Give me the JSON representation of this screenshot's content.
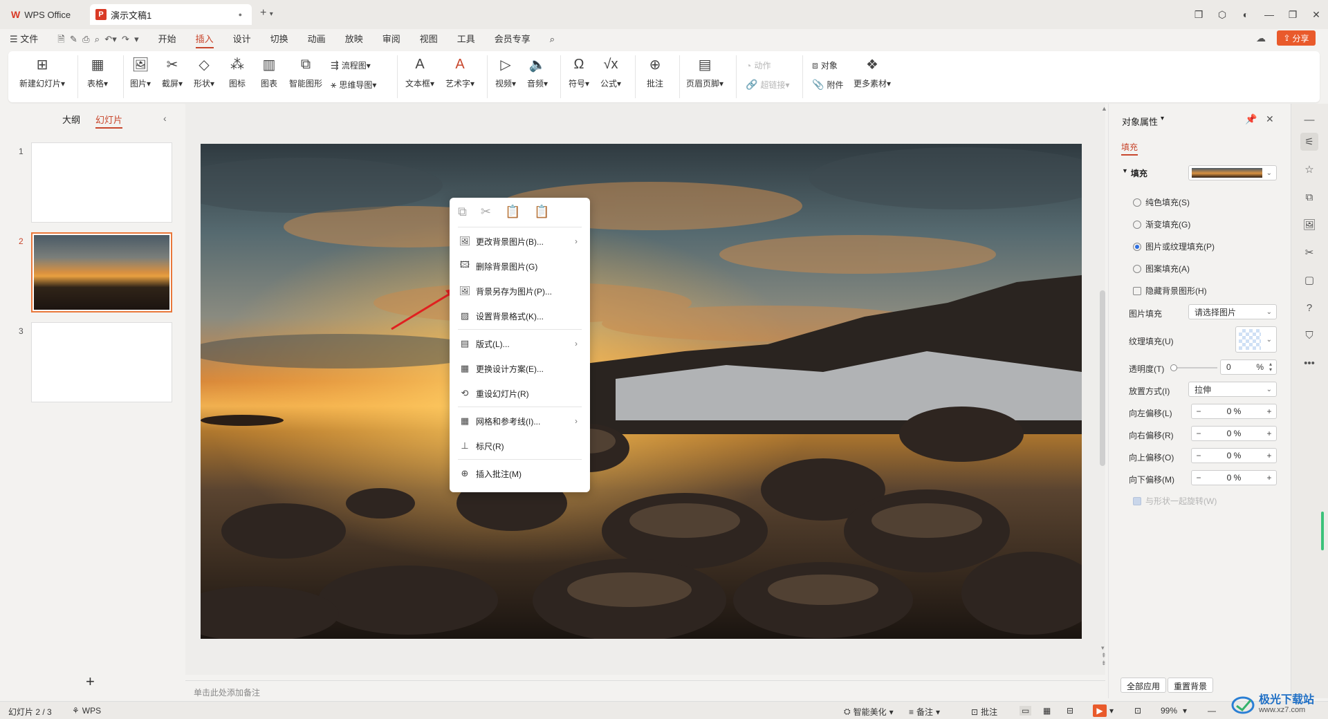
{
  "titlebar": {
    "wps_tab": "WPS Office",
    "doc_tab": "演示文稿1",
    "new_tab": "+"
  },
  "menubar": {
    "file": "文件",
    "items": [
      "开始",
      "插入",
      "设计",
      "切换",
      "动画",
      "放映",
      "审阅",
      "视图",
      "工具",
      "会员专享"
    ],
    "active": "插入",
    "share": "分享"
  },
  "ribbon": {
    "new_slide": "新建幻灯片",
    "table": "表格",
    "picture": "图片",
    "screenshot": "截屏",
    "shape": "形状",
    "icon": "图标",
    "chart": "图表",
    "smart_graphic": "智能图形",
    "flowchart": "流程图",
    "mindmap": "思维导图",
    "textbox": "文本框",
    "wordart": "艺术字",
    "video": "视频",
    "audio": "音频",
    "symbol": "符号",
    "formula": "公式",
    "comment": "批注",
    "header_footer": "页眉页脚",
    "action": "动作",
    "hyperlink": "超链接",
    "object": "对象",
    "attachment": "附件",
    "more_materials": "更多素材"
  },
  "left_panel": {
    "tab_outline": "大纲",
    "tab_slides": "幻灯片",
    "slides": [
      "1",
      "2",
      "3"
    ],
    "selected_slide": 2
  },
  "context_menu": {
    "items": [
      {
        "label": "更改背景图片(B)...",
        "submenu": true
      },
      {
        "label": "删除背景图片(G)",
        "submenu": false
      },
      {
        "label": "背景另存为图片(P)...",
        "submenu": false
      },
      {
        "label": "设置背景格式(K)...",
        "submenu": false
      },
      {
        "label": "版式(L)...",
        "submenu": true
      },
      {
        "label": "更换设计方案(E)...",
        "submenu": false
      },
      {
        "label": "重设幻灯片(R)",
        "submenu": false
      },
      {
        "label": "网格和参考线(I)...",
        "submenu": true
      },
      {
        "label": "标尺(R)",
        "submenu": false
      },
      {
        "label": "插入批注(M)",
        "submenu": false
      }
    ]
  },
  "notes": {
    "placeholder": "单击此处添加备注"
  },
  "right_panel": {
    "title": "对象属性",
    "tab": "填充",
    "section": "填充",
    "options": [
      "纯色填充(S)",
      "渐变填充(G)",
      "图片或纹理填充(P)",
      "图案填充(A)"
    ],
    "selected_option": "图片或纹理填充(P)",
    "hide_bg": "隐藏背景图形(H)",
    "picture_fill_label": "图片填充",
    "picture_fill_value": "请选择图片",
    "texture_fill_label": "纹理填充(U)",
    "transparency_label": "透明度(T)",
    "transparency_value": "0",
    "transparency_unit": "%",
    "placement_label": "放置方式(I)",
    "placement_value": "拉伸",
    "offsets": [
      {
        "label": "向左偏移(L)",
        "value": "0 %"
      },
      {
        "label": "向右偏移(R)",
        "value": "0 %"
      },
      {
        "label": "向上偏移(O)",
        "value": "0 %"
      },
      {
        "label": "向下偏移(M)",
        "value": "0 %"
      }
    ],
    "rotate_with_shape": "与形状一起旋转(W)",
    "apply_all": "全部应用",
    "reset_bg": "重置背景"
  },
  "statusbar": {
    "slide_info": "幻灯片 2 / 3",
    "wps": "WPS",
    "smart_beautify": "智能美化",
    "notes": "备注",
    "comments": "批注",
    "zoom": "99%"
  },
  "watermark": {
    "text": "极光下载站",
    "url": "www.xz7.com"
  },
  "colors": {
    "accent": "#c8462c",
    "share": "#e95a2b",
    "radio_on": "#2d6fe0"
  }
}
